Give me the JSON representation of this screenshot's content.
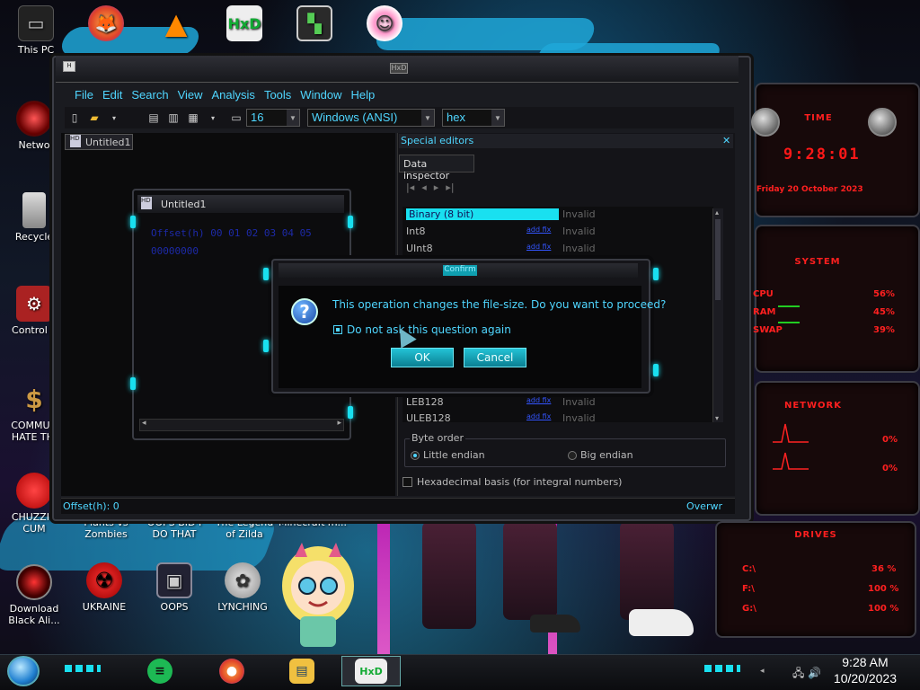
{
  "desktop": {
    "icons_top": [
      {
        "label": "This PC",
        "icon": "computer-icon"
      },
      {
        "label": "",
        "icon": "firefox-icon"
      },
      {
        "label": "",
        "icon": "vlc-icon"
      },
      {
        "label": "",
        "icon": "hxd-icon"
      },
      {
        "label": "",
        "icon": "app-icon"
      },
      {
        "label": "",
        "icon": "doctor-icon"
      }
    ],
    "icons_left": [
      {
        "label": "Netwo",
        "icon": "network-icon"
      },
      {
        "label": "Recycle",
        "icon": "recycle-bin-icon"
      },
      {
        "label": "Control P",
        "icon": "control-panel-icon"
      },
      {
        "label": "COMMUN HATE THI",
        "icon": "money-bag-icon"
      },
      {
        "label": "CHUZZIN CUM",
        "icon": "chuzzle-icon"
      },
      {
        "label": "Download Black Ali...",
        "icon": "alienware-icon"
      }
    ],
    "icons_bottom_partial": [
      "Plants vs Zombies",
      "OOPS BID I DO THAT",
      "The Legend of Zilda",
      "Minecraft4n..."
    ],
    "icons_bottom_row": [
      {
        "label": "UKRAINE",
        "icon": "radiation-icon"
      },
      {
        "label": "OOPS",
        "icon": "tv-icon"
      },
      {
        "label": "LYNCHING",
        "icon": "globe-icon"
      }
    ]
  },
  "hxd": {
    "window_title": "HxD",
    "menu": [
      "File",
      "Edit",
      "Search",
      "View",
      "Analysis",
      "Tools",
      "Window",
      "Help"
    ],
    "toolbar": {
      "bytes_per_row": "16",
      "charset": "Windows (ANSI)",
      "offset_base": "hex"
    },
    "doc_tab": "Untitled1",
    "subwindow_title": "Untitled1",
    "hex_lines": [
      "Offset(h) 00 01 02 03 04 05",
      "00000000"
    ],
    "special_editors": {
      "title": "Special editors",
      "tab": "Data inspector",
      "rows": [
        {
          "name": "Binary (8 bit)",
          "link": "",
          "value": "Invalid",
          "selected": true
        },
        {
          "name": "Int8",
          "link": "add fix",
          "value": "Invalid",
          "selected": false
        },
        {
          "name": "UInt8",
          "link": "add fix",
          "value": "Invalid",
          "selected": false
        },
        {
          "name": "LEB128",
          "link": "add fix",
          "value": "Invalid",
          "selected": false
        },
        {
          "name": "ULEB128",
          "link": "add fix",
          "value": "Invalid",
          "selected": false
        }
      ],
      "byte_order_label": "Byte order",
      "little_endian": "Little endian",
      "big_endian": "Big endian",
      "byte_order_selected": "little",
      "hex_basis": "Hexadecimal basis (for integral numbers)"
    },
    "status": {
      "offset": "Offset(h): 0",
      "mode": "Overwr"
    }
  },
  "dialog": {
    "title": "Confirm",
    "message": "This operation changes the file-size. Do you want to proceed?",
    "checkbox": "Do not ask this question again",
    "checkbox_checked": true,
    "ok": "OK",
    "cancel": "Cancel"
  },
  "gadgets": {
    "time_title": "TIME",
    "time": "9:28:01",
    "date": "Friday 20 October 2023",
    "system_title": "SYSTEM",
    "system_rows": [
      {
        "label": "CPU",
        "value": "56%"
      },
      {
        "label": "RAM",
        "value": "45%"
      },
      {
        "label": "SWAP",
        "value": "39%"
      }
    ],
    "network_title": "NETWORK",
    "network_rows": [
      {
        "value": "0%"
      },
      {
        "value": "0%"
      }
    ],
    "drives_title": "DRIVES",
    "drives_rows": [
      {
        "label": "C:\\",
        "value": "36 %"
      },
      {
        "label": "F:\\",
        "value": "100 %"
      },
      {
        "label": "G:\\",
        "value": "100 %"
      }
    ]
  },
  "taskbar": {
    "apps": [
      "spotify-icon",
      "firefox-icon",
      "explorer-icon",
      "hxd-icon"
    ],
    "time": "9:28 AM",
    "date": "10/20/2023"
  },
  "colors": {
    "accent": "#4fd6ff",
    "glow": "#19e0f0",
    "gadget_red": "#ff1f1f"
  }
}
